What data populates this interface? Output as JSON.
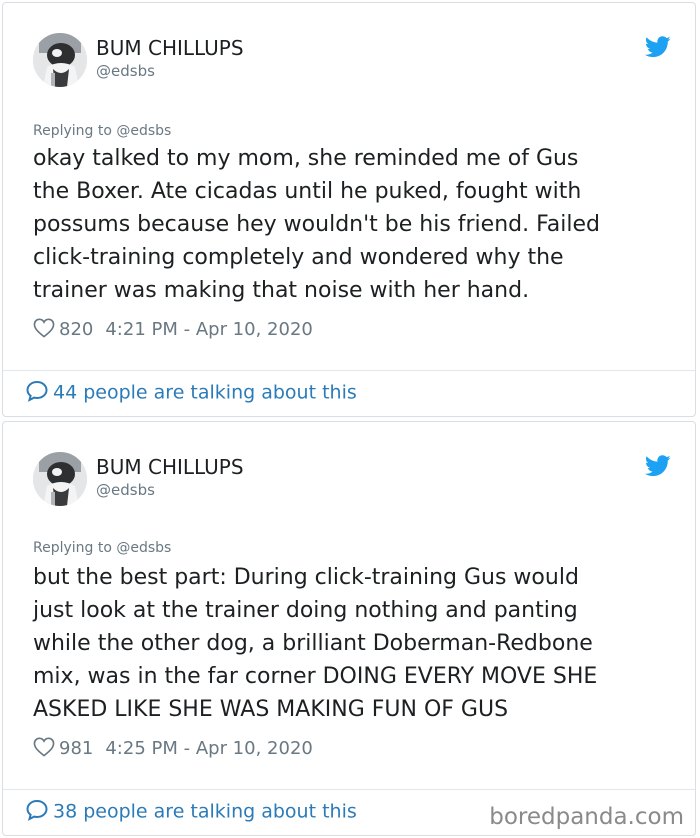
{
  "tweets": [
    {
      "author_name": "BUM CHILLUPS",
      "author_handle": "@edsbs",
      "replying_to": "Replying to @edsbs",
      "text_lines": [
        "okay talked to my mom, she reminded me of Gus",
        "the Boxer. Ate cicadas until he puked, fought with",
        "possums because hey wouldn't be his friend. Failed",
        "click-training completely and wondered why the",
        "trainer was making that noise with her hand."
      ],
      "likes": "820",
      "timestamp": "4:21 PM - Apr 10, 2020",
      "talking": "44 people are talking about this"
    },
    {
      "author_name": "BUM CHILLUPS",
      "author_handle": "@edsbs",
      "replying_to": "Replying to @edsbs",
      "text_lines": [
        "but the best part: During click-training Gus would",
        "just look at the trainer doing nothing and panting",
        "while the other dog, a brilliant Doberman-Redbone",
        "mix, was in the far corner DOING EVERY MOVE SHE",
        "ASKED LIKE SHE WAS MAKING FUN OF GUS"
      ],
      "likes": "981",
      "timestamp": "4:25 PM - Apr 10, 2020",
      "talking": "38 people are talking about this"
    }
  ],
  "watermark": "boredpanda.com",
  "icons": {
    "brand": "twitter-bird-icon",
    "like": "heart-icon",
    "reply": "speech-bubble-icon"
  },
  "colors": {
    "twitter_blue": "#1da1f2",
    "link_blue": "#2b7bb9",
    "meta_gray": "#697882",
    "border": "#d8dee2"
  }
}
